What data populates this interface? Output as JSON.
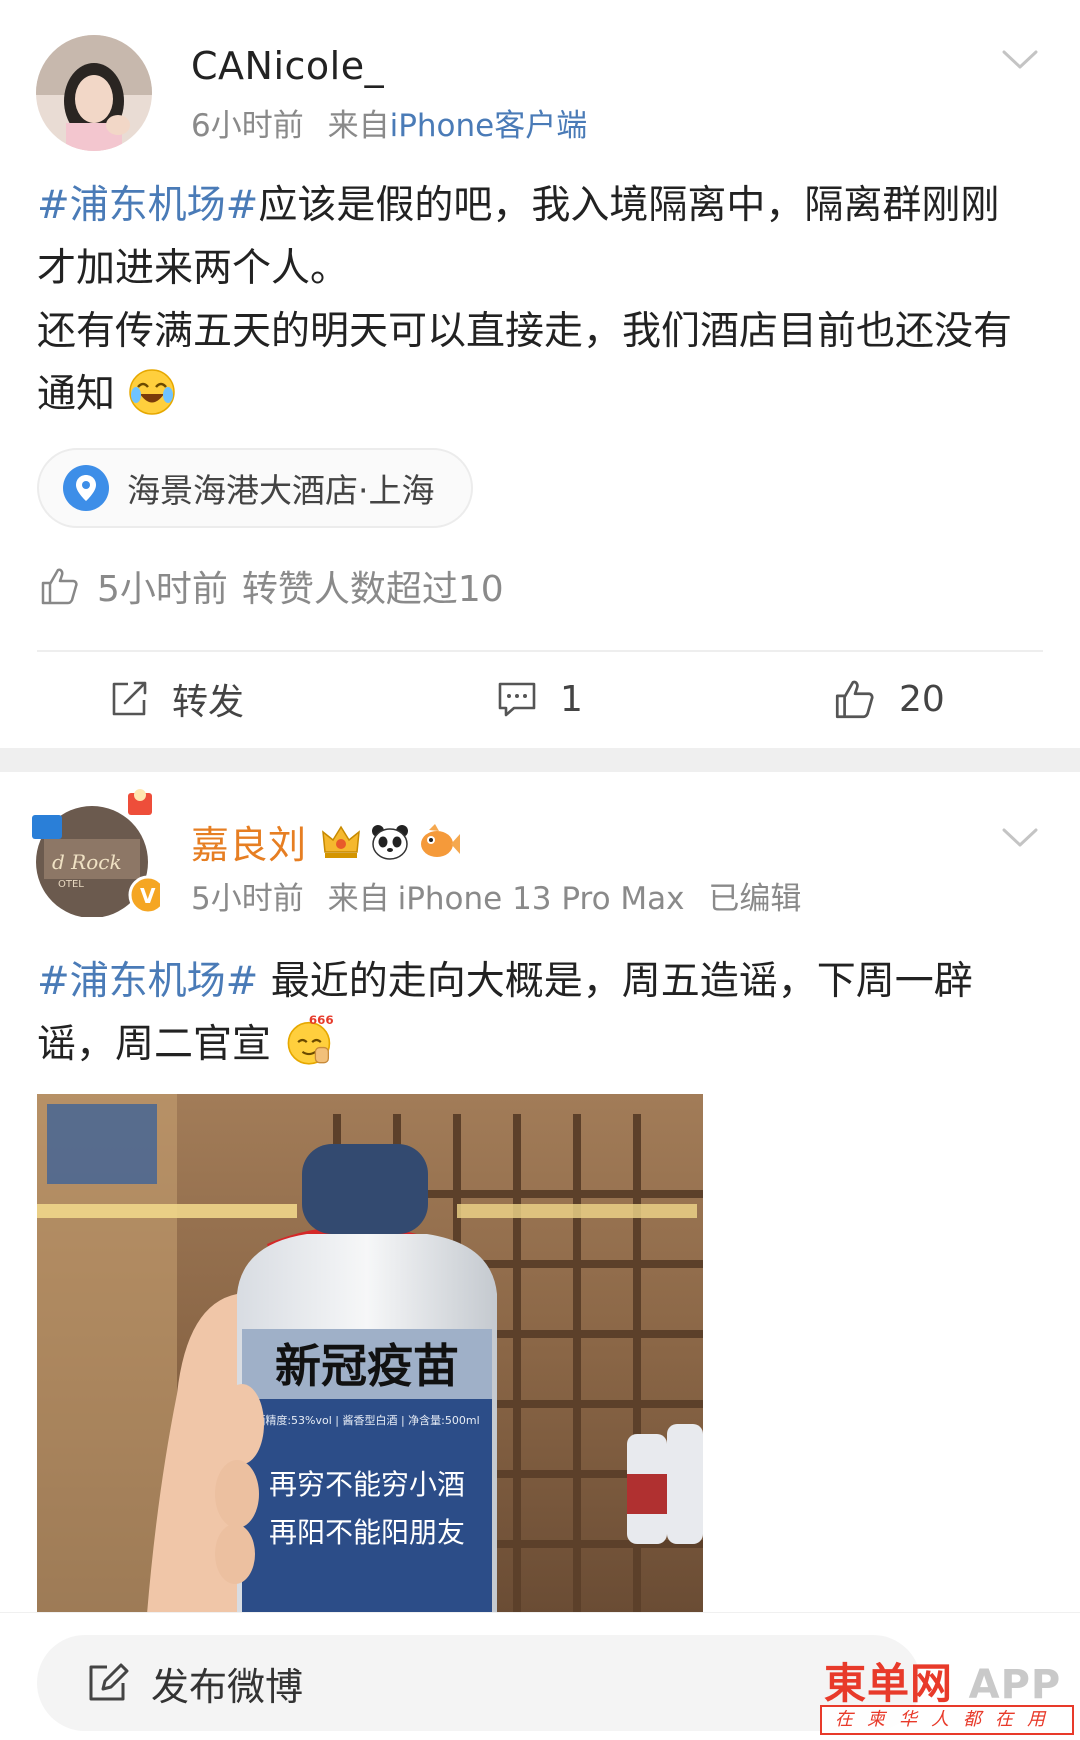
{
  "colors": {
    "link": "#4a7bb7",
    "vip_name": "#e67e22",
    "verified_badge": "#f5a623",
    "meta_text": "#8a8a8a",
    "watermark_red": "#e83a2a"
  },
  "posts": [
    {
      "author": "CANicole_",
      "time": "6小时前",
      "source_prefix": "来自",
      "source": "iPhone客户端",
      "topic": "#浦东机场#",
      "text_line1": "应该是假的吧，我入境隔离中，隔离群刚刚才加进来两个人。",
      "text_line2": "还有传满五天的明天可以直接走，我们酒店目前也还没有通知",
      "emoji": "laughing-crying-icon",
      "location": "海景海港大酒店·上海",
      "likes_line": {
        "time": "5小时前",
        "text": "转赞人数超过10"
      },
      "actions": {
        "repost_label": "转发",
        "comment_count": "1",
        "like_count": "20"
      }
    },
    {
      "author": "嘉良刘",
      "time": "5小时前",
      "source_prefix": "来自",
      "source": "iPhone 13 Pro Max",
      "edited": "已编辑",
      "topic": "#浦东机场#",
      "text": " 最近的走向大概是，周五造谣，下周一辟谣，周二官宣",
      "emoji": "666-thumb-icon",
      "image_label": {
        "title": "新冠疫苗",
        "spec": "酒精度:53%vol | 酱香型白酒 | 净含量:500ml",
        "slogan1": "再穷不能穷小酒",
        "slogan2": "再阳不能阳朋友"
      }
    }
  ],
  "composer": {
    "label": "发布微博"
  },
  "watermark": {
    "brand": "東单网",
    "app": "APP",
    "tagline": "在柬华人都在用"
  }
}
